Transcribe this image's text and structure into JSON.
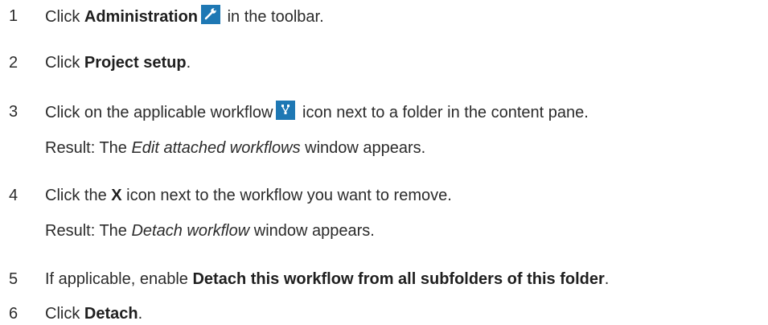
{
  "colors": {
    "text": "#2b2b2b",
    "icon_bg": "#1e78b4"
  },
  "icons": {
    "administration": "wrench-icon",
    "workflow": "workflow-icon"
  },
  "steps": [
    {
      "num": "1",
      "a": "Click ",
      "b": "Administration",
      "c": " in the toolbar."
    },
    {
      "num": "2",
      "a": "Click ",
      "b": "Project setup",
      "c": "."
    },
    {
      "num": "3",
      "a": "Click on the applicable workflow",
      "c": " icon next to a folder in the content pane."
    },
    {
      "result_a": "Result: The ",
      "result_i": "Edit attached workflows",
      "result_c": " window appears."
    },
    {
      "num": "4",
      "a": "Click the ",
      "b": "X",
      "c": " icon next to the workflow you want to remove."
    },
    {
      "result_a": "Result: The ",
      "result_i": "Detach workflow",
      "result_c": " window appears."
    },
    {
      "num": "5",
      "a": "If applicable, enable ",
      "b": "Detach this workflow from all subfolders of this folder",
      "c": "."
    },
    {
      "num": "6",
      "a": "Click ",
      "b": "Detach",
      "c": "."
    }
  ]
}
